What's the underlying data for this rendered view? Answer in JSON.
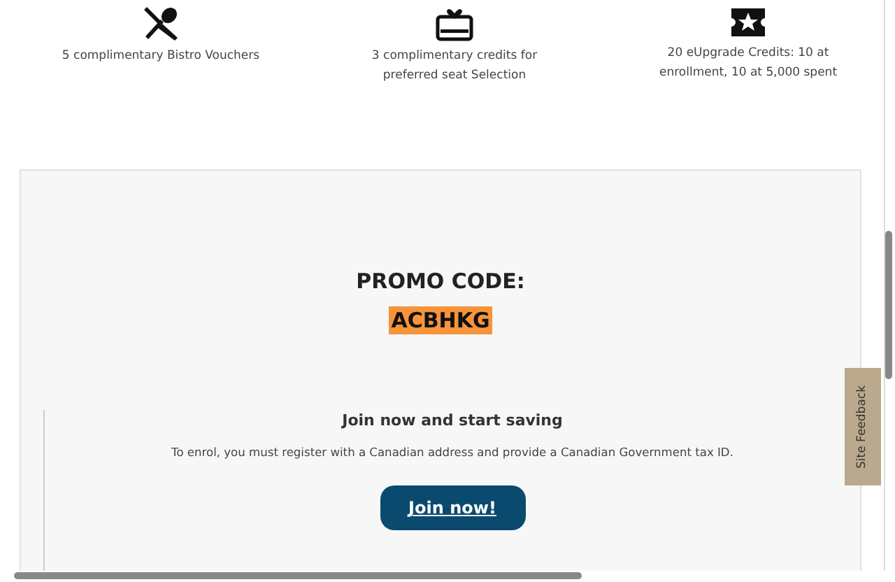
{
  "benefits": [
    {
      "kind": "dining",
      "text": "5 complimentary Bistro Vouchers"
    },
    {
      "kind": "gift",
      "text": "3 complimentary credits for preferred seat Selection"
    },
    {
      "kind": "ticket",
      "text": "20 eUpgrade Credits: 10 at enrollment, 10 at 5,000 spent"
    }
  ],
  "promo": {
    "label": "PROMO CODE:",
    "code": "ACBHKG"
  },
  "join": {
    "heading": "Join now and start saving",
    "text": "To enrol, you must register with a Canadian address and provide a Canadian Government tax ID.",
    "button": "Join now!"
  },
  "feedback_tab": "Site Feedback"
}
